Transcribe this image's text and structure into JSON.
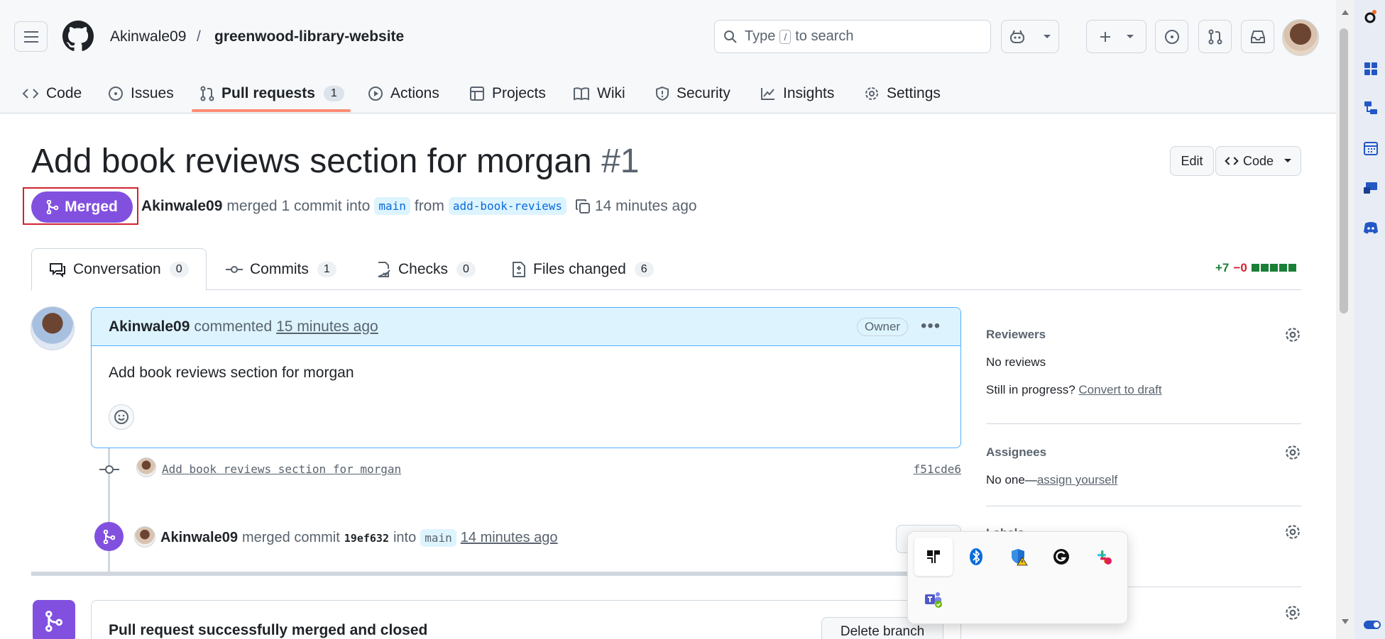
{
  "header": {
    "owner": "Akinwale09",
    "separator": "/",
    "repo": "greenwood-library-website",
    "search": {
      "prefix": "Type",
      "key": "/",
      "suffix": "to search"
    }
  },
  "repo_tabs": [
    {
      "label": "Code",
      "icon": "code-icon"
    },
    {
      "label": "Issues",
      "icon": "issue-icon"
    },
    {
      "label": "Pull requests",
      "icon": "pull-request-icon",
      "count": "1",
      "active": true
    },
    {
      "label": "Actions",
      "icon": "play-icon"
    },
    {
      "label": "Projects",
      "icon": "table-icon"
    },
    {
      "label": "Wiki",
      "icon": "book-icon"
    },
    {
      "label": "Security",
      "icon": "shield-icon"
    },
    {
      "label": "Insights",
      "icon": "graph-icon"
    },
    {
      "label": "Settings",
      "icon": "gear-icon"
    }
  ],
  "pr": {
    "title": "Add book reviews section for morgan",
    "number": "#1",
    "edit_label": "Edit",
    "code_label": "Code",
    "state": "Merged",
    "meta": {
      "author": "Akinwale09",
      "action": "merged 1 commit into",
      "base": "main",
      "from": "from",
      "head": "add-book-reviews",
      "time": "14 minutes ago"
    }
  },
  "pr_tabs": [
    {
      "label": "Conversation",
      "count": "0"
    },
    {
      "label": "Commits",
      "count": "1"
    },
    {
      "label": "Checks",
      "count": "0"
    },
    {
      "label": "Files changed",
      "count": "6"
    }
  ],
  "diffstat": {
    "additions": "+7",
    "deletions": "−0"
  },
  "comment": {
    "author": "Akinwale09",
    "verb": "commented",
    "time": "15 minutes ago",
    "badge": "Owner",
    "body": "Add book reviews section for morgan"
  },
  "commit": {
    "message": "Add book reviews section for morgan",
    "sha": "f51cde6"
  },
  "merge_event": {
    "author": "Akinwale09",
    "verb": "merged commit",
    "sha": "19ef632",
    "into": "into",
    "base": "main",
    "time": "14 minutes ago"
  },
  "merged_panel": {
    "title": "Pull request successfully merged and closed",
    "delete_label": "Delete branch"
  },
  "sidebar": {
    "reviewers": {
      "heading": "Reviewers",
      "value": "No reviews",
      "draft_prefix": "Still in progress?",
      "draft_link": "Convert to draft"
    },
    "assignees": {
      "heading": "Assignees",
      "value_prefix": "No one—",
      "value_link": "assign yourself"
    },
    "labels": {
      "heading": "Labels"
    }
  },
  "colors": {
    "merged": "#8250df",
    "accent_underline": "#fd8c73",
    "highlight_box": "#d1242f",
    "link_blue": "#0969da"
  }
}
